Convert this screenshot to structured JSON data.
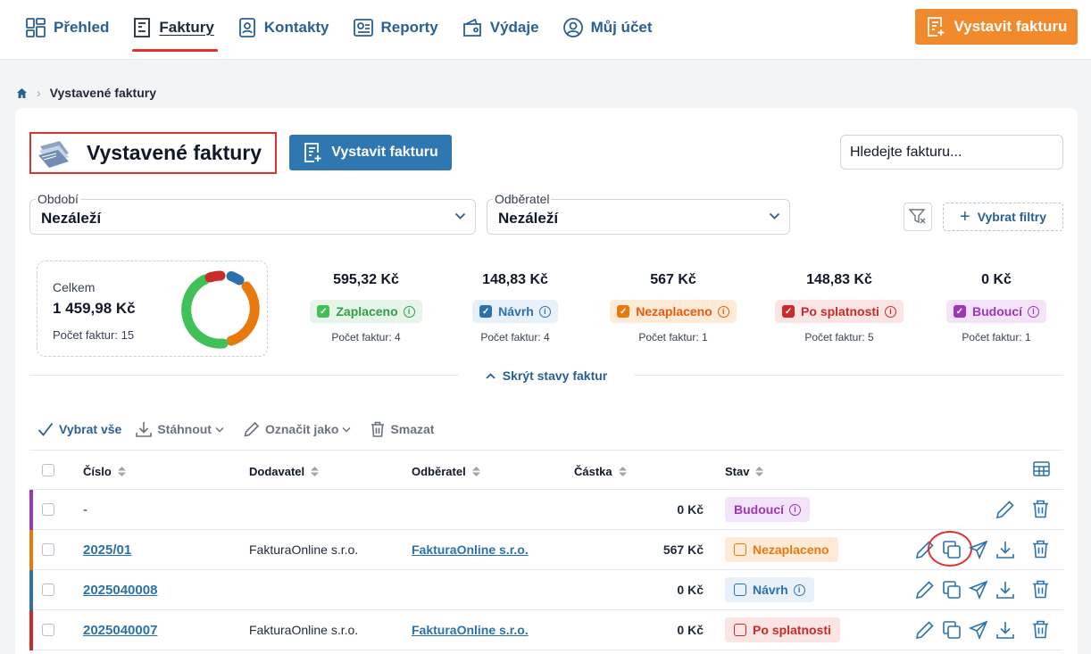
{
  "nav": [
    {
      "label": "Přehled",
      "icon": "grid-icon"
    },
    {
      "label": "Faktury",
      "icon": "invoice-icon",
      "active": true
    },
    {
      "label": "Kontakty",
      "icon": "contact-icon"
    },
    {
      "label": "Reporty",
      "icon": "report-icon"
    },
    {
      "label": "Výdaje",
      "icon": "wallet-icon"
    },
    {
      "label": "Můj účet",
      "icon": "user-icon"
    }
  ],
  "top_cta": "Vystavit fakturu",
  "breadcrumb": {
    "current": "Vystavené faktury"
  },
  "page_title": "Vystavené faktury",
  "issue_button": "Vystavit fakturu",
  "search": {
    "placeholder": "Hledejte fakturu..."
  },
  "filters": {
    "period": {
      "label": "Období",
      "value": "Nezáleží"
    },
    "customer": {
      "label": "Odběratel",
      "value": "Nezáleží"
    },
    "pick_filters": "Vybrat filtry"
  },
  "summary": {
    "total_label": "Celkem",
    "total_amount": "1 459,98 Kč",
    "total_count": "Počet faktur: 15"
  },
  "stats": [
    {
      "amount": "595,32 Kč",
      "label": "Zaplaceno",
      "count": "Počet faktur: 4",
      "color": "#2f9e44",
      "bg": "#e6f4ea",
      "fill": "#40c057"
    },
    {
      "amount": "148,83 Kč",
      "label": "Návrh",
      "count": "Počet faktur: 4",
      "color": "#2a72ad",
      "bg": "#e8f1f9",
      "fill": "#2a72ad"
    },
    {
      "amount": "567 Kč",
      "label": "Nezaplaceno",
      "count": "Počet faktur: 1",
      "color": "#e8590c",
      "bg": "#fdebd8",
      "fill": "#e8790c"
    },
    {
      "amount": "148,83 Kč",
      "label": "Po splatnosti",
      "count": "Počet faktur: 5",
      "color": "#c92a2a",
      "bg": "#fbe4e4",
      "fill": "#c92a2a"
    },
    {
      "amount": "0 Kč",
      "label": "Budoucí",
      "count": "Počet faktur: 1",
      "color": "#9c36b5",
      "bg": "#f3e3f8",
      "fill": "#9c36b5"
    }
  ],
  "hide_states": "Skrýt stavy faktur",
  "bulk": {
    "select_all": "Vybrat vše",
    "download": "Stáhnout",
    "mark_as": "Označit jako",
    "delete": "Smazat"
  },
  "table": {
    "columns": [
      "Číslo",
      "Dodavatel",
      "Odběratel",
      "Částka",
      "Stav"
    ],
    "rows": [
      {
        "number": "-",
        "supplier": "",
        "customer": "",
        "amount": "0 Kč",
        "status": "Budoucí",
        "color": "#9c36b5",
        "bg": "#f3e3f8",
        "info": true
      },
      {
        "number": "2025/01",
        "supplier": "FakturaOnline s.r.o.",
        "customer": "FakturaOnline s.r.o.",
        "amount": "567 Kč",
        "status": "Nezaplaceno",
        "color": "#e8790c",
        "bg": "#fdebd8",
        "info": false
      },
      {
        "number": "2025040008",
        "supplier": "",
        "customer": "",
        "amount": "0 Kč",
        "status": "Návrh",
        "color": "#2a72ad",
        "bg": "#e8f1f9",
        "info": true
      },
      {
        "number": "2025040007",
        "supplier": "FakturaOnline s.r.o.",
        "customer": "FakturaOnline s.r.o.",
        "amount": "0 Kč",
        "status": "Po splatnosti",
        "color": "#c92a2a",
        "bg": "#fbe4e4",
        "info": false
      }
    ]
  }
}
